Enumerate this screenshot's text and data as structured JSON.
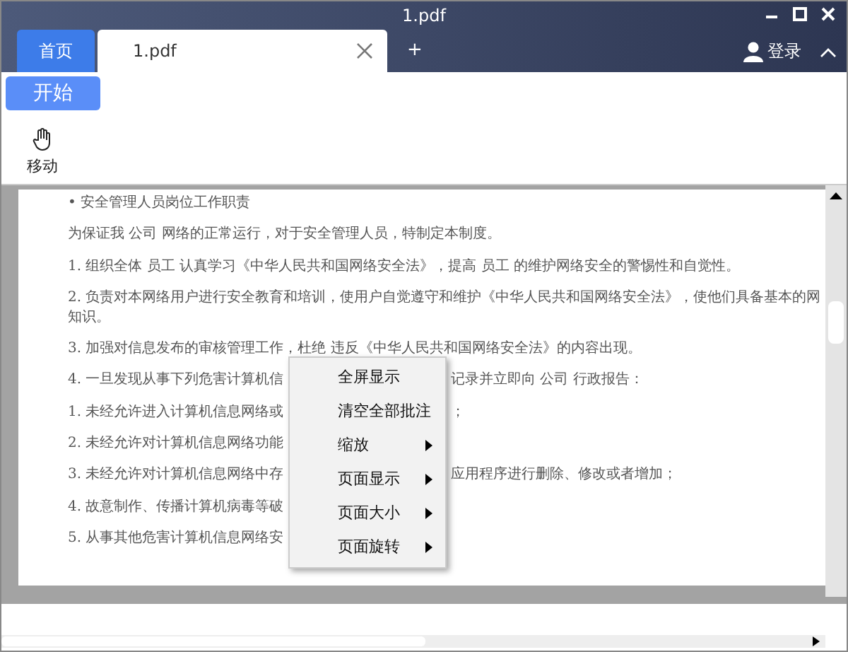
{
  "window": {
    "title": "1.pdf"
  },
  "tabs": [
    {
      "label": "首页",
      "selected": false,
      "closable": false
    },
    {
      "label": "1.pdf",
      "selected": true,
      "closable": true
    }
  ],
  "new_tab": "+",
  "account": {
    "label": "登录"
  },
  "ribbon_tabs": [
    {
      "label": "开始",
      "selected": true
    }
  ],
  "tools": [
    {
      "label": "移动"
    }
  ],
  "document": {
    "lines": [
      {
        "text": "• 安全管理人员岗位工作职责"
      },
      {
        "text": "为保证我 公司 网络的正常运行，对于安全管理人员，特制定本制度。"
      },
      {
        "text": "1. 组织全体 员工 认真学习《中华人民共和国网络安全法》，提高 员工 的维护网络安全的警惕性和自觉性。"
      },
      {
        "text": "2. 负责对本网络用户进行安全教育和培训，使用户自觉遵守和维护《中华人民共和国网络安全法》，使他们具备基本的网",
        "continued": "知识。"
      },
      {
        "text": "3. 加强对信息发布的审核管理工作，杜绝 违反《中华人民共和国网络安全法》的内容出现。"
      },
      {
        "text": "4. 一旦发现从事下列危害计算机信",
        "tail": "记录并立即向 公司 行政报告："
      },
      {
        "text": "1. 未经允许进入计算机信息网络或",
        "tail": "；"
      },
      {
        "text": "2. 未经允许对计算机信息网络功能"
      },
      {
        "text": "3. 未经允许对计算机信息网络中存",
        "tail": "应用程序进行删除、修改或者增加；"
      },
      {
        "text": "4. 故意制作、传播计算机病毒等破"
      },
      {
        "text": "5. 从事其他危害计算机信息网络安"
      }
    ]
  },
  "context_menu": {
    "items": [
      {
        "label": "全屏显示",
        "submenu": false
      },
      {
        "label": "清空全部批注",
        "submenu": false
      },
      {
        "label": "缩放",
        "submenu": true
      },
      {
        "label": "页面显示",
        "submenu": true
      },
      {
        "label": "页面大小",
        "submenu": true
      },
      {
        "label": "页面旋转",
        "submenu": true
      }
    ]
  }
}
